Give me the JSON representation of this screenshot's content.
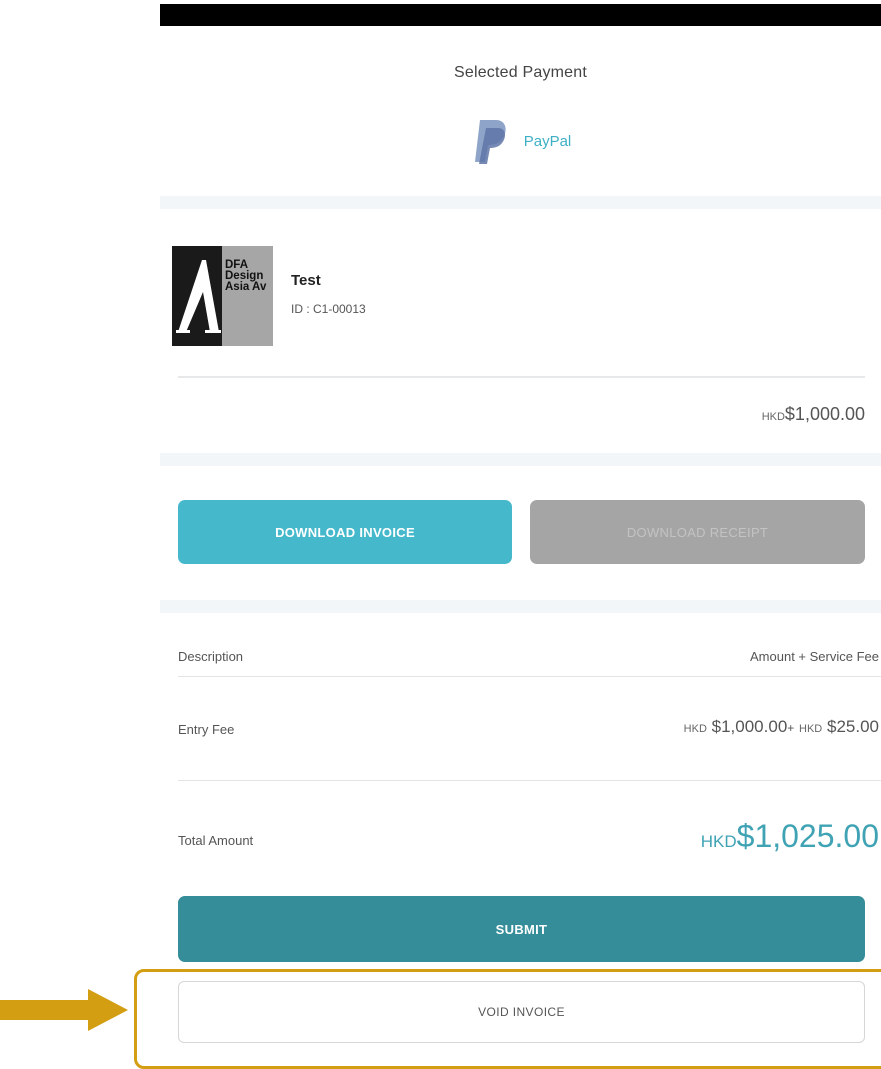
{
  "payment": {
    "heading": "Selected Payment",
    "method": "PayPal",
    "icon": "paypal-logo-icon"
  },
  "entry": {
    "thumbnail_text": "DFA\nDesign\nAsia Av",
    "name": "Test",
    "id": "ID : C1-00013",
    "currency": "HKD",
    "amount": "$1,000.00"
  },
  "actions": {
    "download_invoice": "DOWNLOAD INVOICE",
    "download_receipt": "DOWNLOAD RECEIPT",
    "submit": "SUBMIT",
    "void_invoice": "VOID INVOICE"
  },
  "summary": {
    "header_description": "Description",
    "header_amount": "Amount + Service Fee",
    "rows": [
      {
        "label": "Entry Fee",
        "currency1": "HKD",
        "amount1": "$1,000.00",
        "plus": "+",
        "currency2": "HKD",
        "amount2": "$25.00"
      }
    ],
    "total_label": "Total Amount",
    "total_currency": "HKD",
    "total_amount": "$1,025.00"
  },
  "colors": {
    "accent": "#45b8cb",
    "submit": "#358d9a",
    "disabled": "#a5a5a5",
    "highlight": "#d49e13"
  }
}
